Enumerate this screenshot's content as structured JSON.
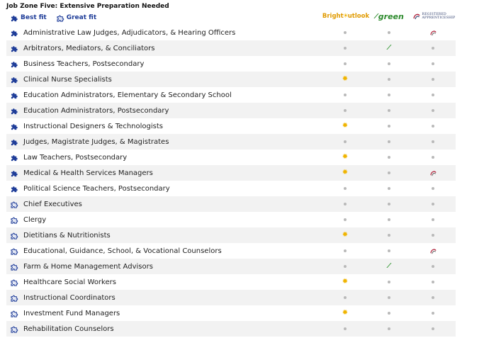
{
  "heading": "Job Zone Five: Extensive Preparation Needed",
  "legend": {
    "best_fit": "Best fit",
    "great_fit": "Great fit"
  },
  "logos": {
    "bright_outlook": "Bright Outlook",
    "bright_pre": "Bright",
    "bright_post": "utlook",
    "green": "green",
    "apprenticeship": [
      "REGISTERED",
      "APPRENTICESHIP"
    ]
  },
  "colors": {
    "fit_best": "#1f3d99",
    "fit_great": "#1f3d99",
    "row_alt": "#f2f2f2",
    "bright": "#f0b400",
    "green": "#2e8b2e"
  },
  "occupations": [
    {
      "title": "Administrative Law Judges, Adjudicators, & Hearing Officers",
      "fit": "best",
      "bright": false,
      "green": false,
      "apprentice": true
    },
    {
      "title": "Arbitrators, Mediators, & Conciliators",
      "fit": "best",
      "bright": false,
      "green": true,
      "apprentice": false
    },
    {
      "title": "Business Teachers, Postsecondary",
      "fit": "best",
      "bright": false,
      "green": false,
      "apprentice": false
    },
    {
      "title": "Clinical Nurse Specialists",
      "fit": "best",
      "bright": true,
      "green": false,
      "apprentice": false
    },
    {
      "title": "Education Administrators, Elementary & Secondary School",
      "fit": "best",
      "bright": false,
      "green": false,
      "apprentice": false
    },
    {
      "title": "Education Administrators, Postsecondary",
      "fit": "best",
      "bright": false,
      "green": false,
      "apprentice": false
    },
    {
      "title": "Instructional Designers & Technologists",
      "fit": "best",
      "bright": true,
      "green": false,
      "apprentice": false
    },
    {
      "title": "Judges, Magistrate Judges, & Magistrates",
      "fit": "best",
      "bright": false,
      "green": false,
      "apprentice": false
    },
    {
      "title": "Law Teachers, Postsecondary",
      "fit": "best",
      "bright": true,
      "green": false,
      "apprentice": false
    },
    {
      "title": "Medical & Health Services Managers",
      "fit": "best",
      "bright": true,
      "green": false,
      "apprentice": true
    },
    {
      "title": "Political Science Teachers, Postsecondary",
      "fit": "best",
      "bright": false,
      "green": false,
      "apprentice": false
    },
    {
      "title": "Chief Executives",
      "fit": "great",
      "bright": false,
      "green": false,
      "apprentice": false
    },
    {
      "title": "Clergy",
      "fit": "great",
      "bright": false,
      "green": false,
      "apprentice": false
    },
    {
      "title": "Dietitians & Nutritionists",
      "fit": "great",
      "bright": true,
      "green": false,
      "apprentice": false
    },
    {
      "title": "Educational, Guidance, School, & Vocational Counselors",
      "fit": "great",
      "bright": false,
      "green": false,
      "apprentice": true
    },
    {
      "title": "Farm & Home Management Advisors",
      "fit": "great",
      "bright": false,
      "green": true,
      "apprentice": false
    },
    {
      "title": "Healthcare Social Workers",
      "fit": "great",
      "bright": true,
      "green": false,
      "apprentice": false
    },
    {
      "title": "Instructional Coordinators",
      "fit": "great",
      "bright": false,
      "green": false,
      "apprentice": false
    },
    {
      "title": "Investment Fund Managers",
      "fit": "great",
      "bright": true,
      "green": false,
      "apprentice": false
    },
    {
      "title": "Rehabilitation Counselors",
      "fit": "great",
      "bright": false,
      "green": false,
      "apprentice": false
    }
  ]
}
